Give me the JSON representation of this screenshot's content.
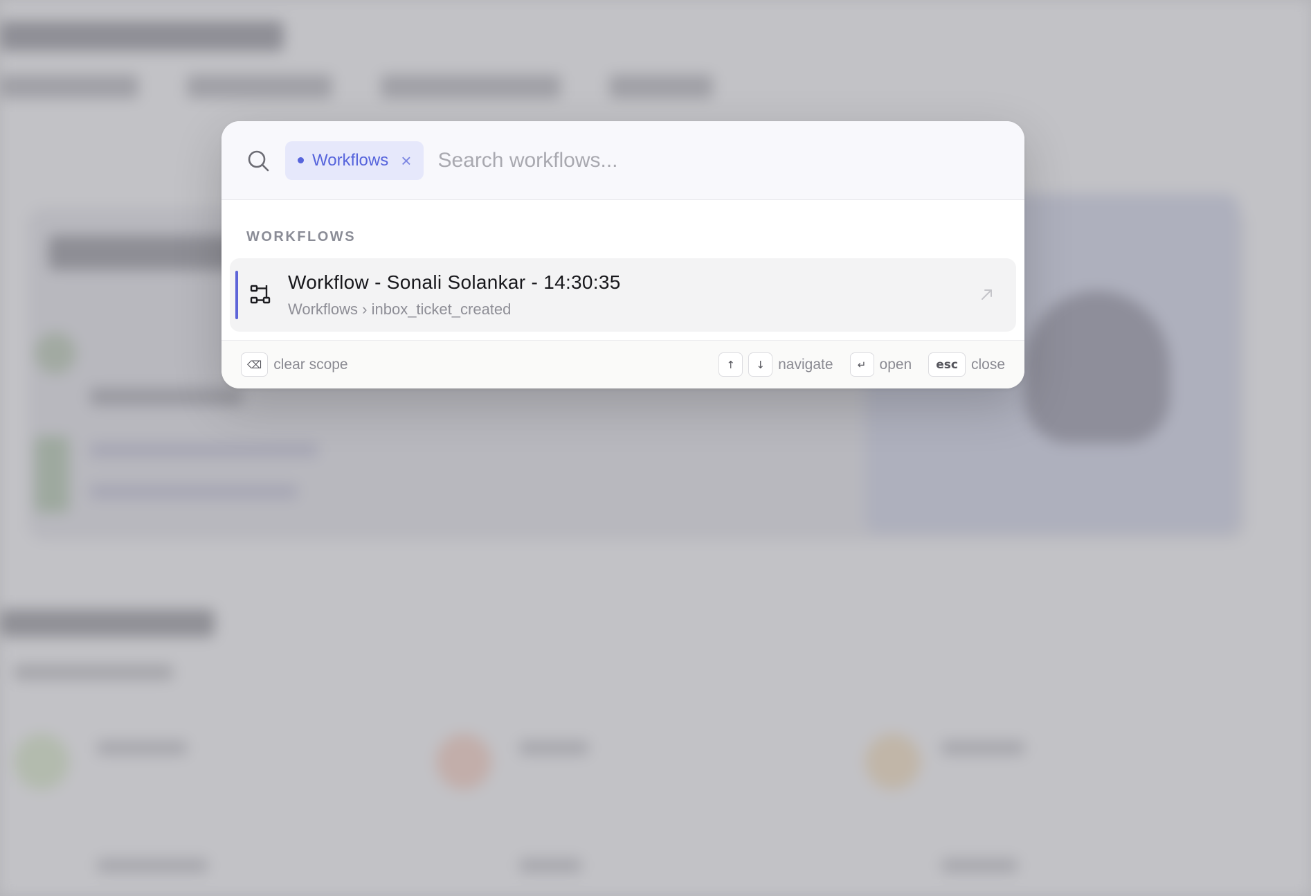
{
  "search": {
    "scope_chip": "Workflows",
    "placeholder": "Search workflows..."
  },
  "results": {
    "section_label": "WORKFLOWS",
    "items": [
      {
        "title": "Workflow - Sonali Solankar - 14:30:35",
        "path": "Workflows › inbox_ticket_created",
        "icon": "workflow-icon",
        "action_icon": "open-external-icon"
      }
    ]
  },
  "footer": {
    "clear_key": "⌫",
    "clear_label": "clear scope",
    "up_key": "↑",
    "down_key": "↓",
    "navigate_label": "navigate",
    "enter_key": "↵",
    "open_label": "open",
    "esc_key": "esc",
    "close_label": "close"
  },
  "colors": {
    "accent": "#5664dc",
    "chip_bg": "#e6e8fb",
    "overlay": "#b4b4b8"
  }
}
